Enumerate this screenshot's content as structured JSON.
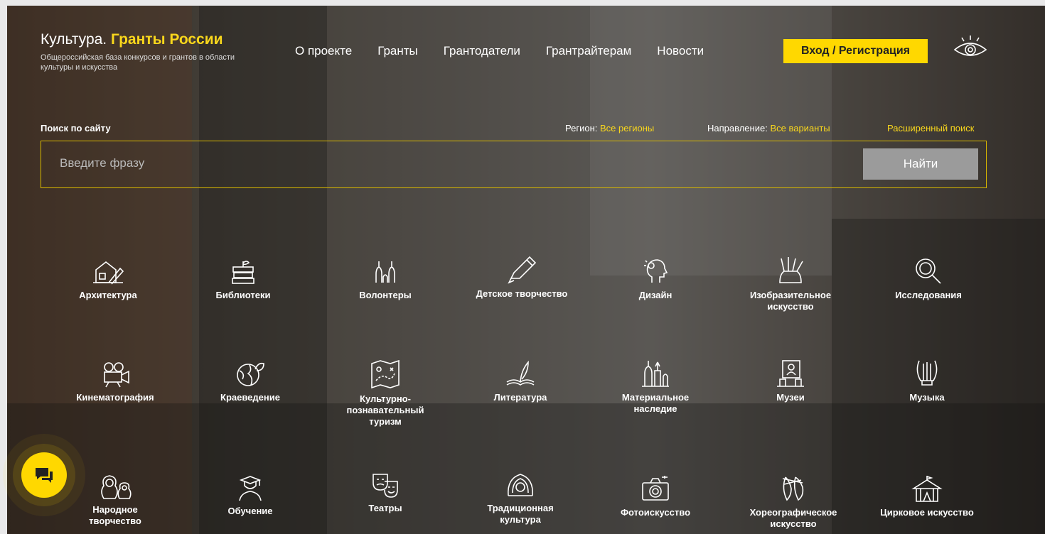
{
  "brand": {
    "title_plain": "Культура. ",
    "title_accent": "Гранты России",
    "subtitle": "Общероссийская база конкурсов и грантов в области культуры и искусства"
  },
  "nav": [
    "О проекте",
    "Гранты",
    "Грантодатели",
    "Грантрайтерам",
    "Новости"
  ],
  "login_label": "Вход / Регистрация",
  "accessibility_icon": "eye-icon",
  "search": {
    "label": "Поиск по сайту",
    "placeholder": "Введите фразу",
    "button": "Найти",
    "region_label": "Регион:",
    "region_value": "Все регионы",
    "direction_label": "Направление:",
    "direction_value": "Все варианты",
    "advanced_link": "Расширенный поиск"
  },
  "categories": [
    {
      "label": "Архитектура",
      "icon": "architecture-icon"
    },
    {
      "label": "Библиотеки",
      "icon": "books-icon"
    },
    {
      "label": "Волонтеры",
      "icon": "raised-hands-icon"
    },
    {
      "label": "Детское творчество",
      "icon": "crayon-icon"
    },
    {
      "label": "Дизайн",
      "icon": "lightbulb-head-icon"
    },
    {
      "label": "Изобразительное искусство",
      "icon": "brushes-icon"
    },
    {
      "label": "Исследования",
      "icon": "magnifier-icon"
    },
    {
      "label": "Кинематография",
      "icon": "film-camera-icon"
    },
    {
      "label": "Краеведение",
      "icon": "globe-leaf-icon"
    },
    {
      "label": "Культурно-познавательный туризм",
      "icon": "map-icon"
    },
    {
      "label": "Литература",
      "icon": "quill-book-icon"
    },
    {
      "label": "Материальное наследие",
      "icon": "kremlin-icon"
    },
    {
      "label": "Музеи",
      "icon": "museum-frame-icon"
    },
    {
      "label": "Музыка",
      "icon": "lyre-icon"
    },
    {
      "label": "Народное творчество",
      "icon": "matryoshka-icon"
    },
    {
      "label": "Обучение",
      "icon": "graduate-icon"
    },
    {
      "label": "Театры",
      "icon": "theatre-masks-icon"
    },
    {
      "label": "Традиционная культура",
      "icon": "kokoshnik-icon"
    },
    {
      "label": "Фотоискусство",
      "icon": "photo-camera-icon"
    },
    {
      "label": "Хореографическое искусство",
      "icon": "pointe-shoes-icon"
    },
    {
      "label": "Цирковое искусство",
      "icon": "circus-tent-icon"
    }
  ],
  "chat_icon": "chat-bubble-icon",
  "colors": {
    "accent": "#ffd800",
    "accent_text": "#f9d71c"
  }
}
